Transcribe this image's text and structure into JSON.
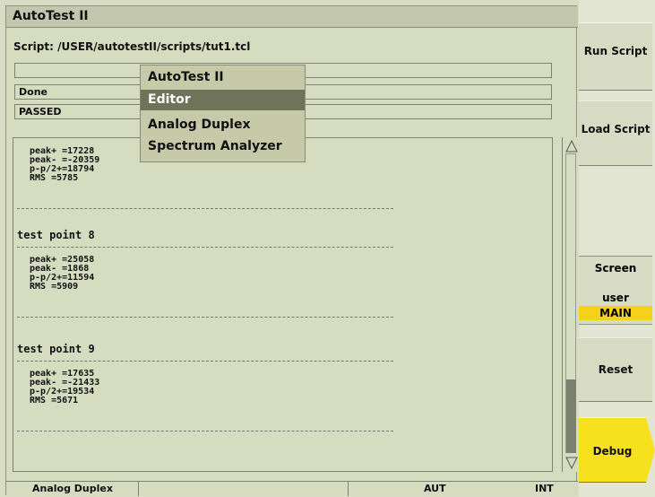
{
  "window": {
    "title": "AutoTest II",
    "script_line": "Script: /USER/autotestII/scripts/tut1.tcl"
  },
  "fields": {
    "blank": "",
    "status": "Done",
    "result": "PASSED"
  },
  "menu": {
    "items": [
      {
        "label": "AutoTest II",
        "selected": false
      },
      {
        "label": "Editor",
        "selected": true
      },
      {
        "label": "Analog Duplex",
        "selected": false
      },
      {
        "label": "Spectrum Analyzer",
        "selected": false
      }
    ]
  },
  "output": {
    "sections": [
      {
        "title": "",
        "rows": [
          {
            "name": "peak+",
            "value": "=17228"
          },
          {
            "name": "peak-",
            "value": "=-20359"
          },
          {
            "name": "p-p/2+",
            "value": "=18794"
          },
          {
            "name": "RMS",
            "value": "=5785"
          }
        ]
      },
      {
        "title": "test point 8",
        "rows": [
          {
            "name": "peak+",
            "value": "=25058"
          },
          {
            "name": "peak-",
            "value": "=1868"
          },
          {
            "name": "p-p/2+",
            "value": "=11594"
          },
          {
            "name": "RMS",
            "value": "=5909"
          }
        ]
      },
      {
        "title": "test point 9",
        "rows": [
          {
            "name": "peak+",
            "value": "=17635"
          },
          {
            "name": "peak-",
            "value": "=-21433"
          },
          {
            "name": "p-p/2+",
            "value": "=19534"
          },
          {
            "name": "RMS",
            "value": "=5671"
          }
        ]
      }
    ]
  },
  "status_bar": {
    "left": "Analog Duplex",
    "middle": "",
    "center": "AUT",
    "right": "INT"
  },
  "softkeys": {
    "run_script": "Run Script",
    "load_script": "Load Script",
    "screen": "Screen",
    "user": "user",
    "main": "MAIN",
    "reset": "Reset",
    "debug": "Debug"
  },
  "colors": {
    "accent_yellow": "#f7e11d",
    "highlight_gray": "#6f7359"
  },
  "icons": {
    "scroll_up": "triangle-up-icon",
    "scroll_down": "triangle-down-icon"
  }
}
